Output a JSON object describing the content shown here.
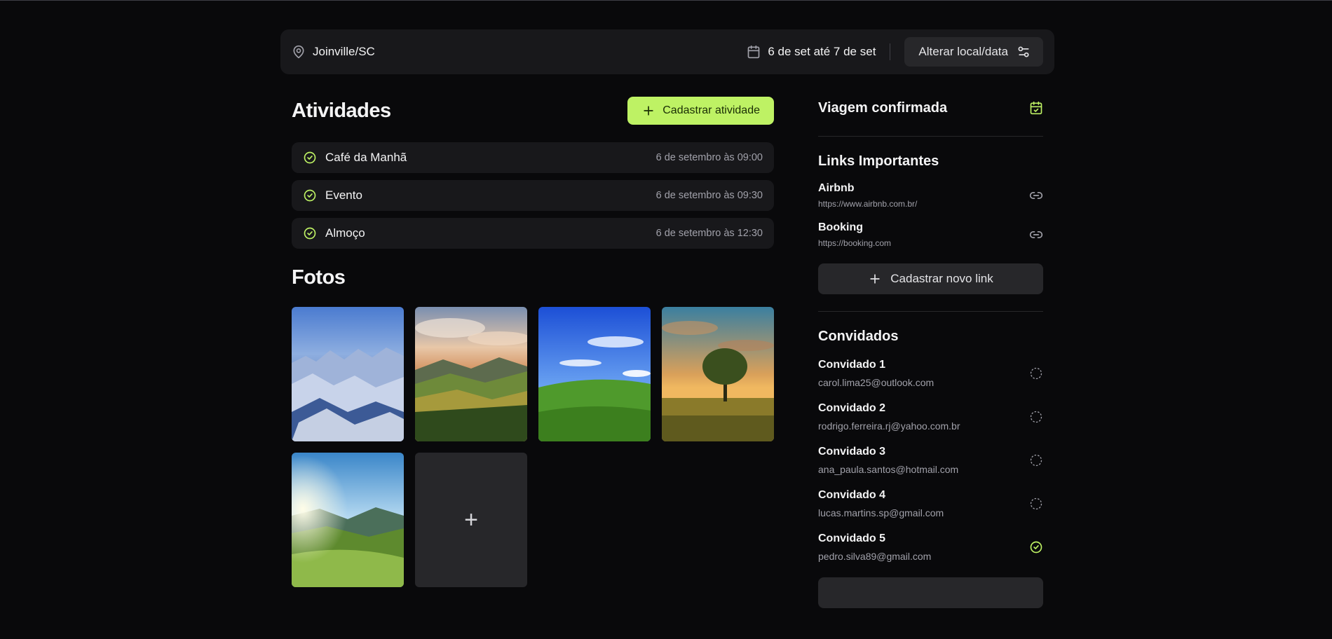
{
  "topbar": {
    "location": "Joinville/SC",
    "dates": "6 de set até 7 de set",
    "change_label": "Alterar local/data"
  },
  "activities": {
    "title": "Atividades",
    "add_label": "Cadastrar atividade",
    "items": [
      {
        "name": "Café da Manhã",
        "time": "6 de setembro às 09:00",
        "done": true
      },
      {
        "name": "Evento",
        "time": "6 de setembro às 09:30",
        "done": true
      },
      {
        "name": "Almoço",
        "time": "6 de setembro às 12:30",
        "done": true
      }
    ]
  },
  "photos": {
    "title": "Fotos",
    "add_symbol": "+",
    "items": [
      "snowy-mountains",
      "valley-sunset",
      "green-hill-blue-sky",
      "lone-tree-field",
      "sunny-mountain-meadow"
    ]
  },
  "sidebar": {
    "trip_status": "Viagem confirmada",
    "links_title": "Links Importantes",
    "links": [
      {
        "name": "Airbnb",
        "url": "https://www.airbnb.com.br/"
      },
      {
        "name": "Booking",
        "url": "https://booking.com"
      }
    ],
    "add_link_label": "Cadastrar novo link",
    "guests_title": "Convidados",
    "guests": [
      {
        "name": "Convidado 1",
        "email": "carol.lima25@outlook.com",
        "confirmed": false
      },
      {
        "name": "Convidado 2",
        "email": "rodrigo.ferreira.rj@yahoo.com.br",
        "confirmed": false
      },
      {
        "name": "Convidado 3",
        "email": "ana_paula.santos@hotmail.com",
        "confirmed": false
      },
      {
        "name": "Convidado 4",
        "email": "lucas.martins.sp@gmail.com",
        "confirmed": false
      },
      {
        "name": "Convidado 5",
        "email": "pedro.silva89@gmail.com",
        "confirmed": true
      }
    ]
  },
  "colors": {
    "accent": "#bef264",
    "background": "#09090b",
    "surface": "#18181b"
  }
}
